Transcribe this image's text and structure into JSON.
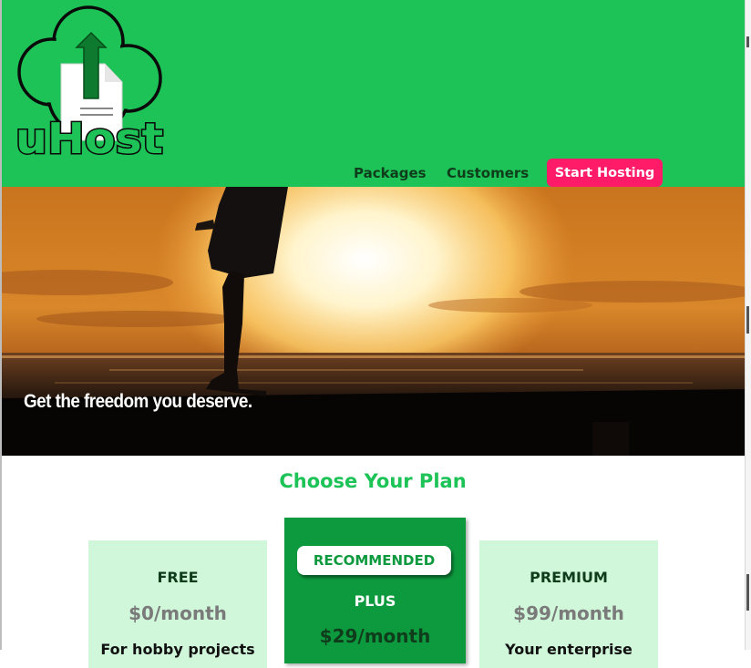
{
  "header": {
    "logo_text": "uHost",
    "nav": [
      {
        "label": "Packages"
      },
      {
        "label": "Customers"
      }
    ],
    "cta_label": "Start Hosting"
  },
  "hero": {
    "text": "Get the freedom you deserve."
  },
  "plans": {
    "title": "Choose Your Plan",
    "items": [
      {
        "name": "FREE",
        "price": "$0/month",
        "desc": "For hobby projects"
      },
      {
        "badge": "RECOMMENDED",
        "name": "PLUS",
        "price": "$29/month"
      },
      {
        "name": "PREMIUM",
        "price": "$99/month",
        "desc": "Your enterprise"
      }
    ]
  },
  "colors": {
    "brand_green": "#1dc356",
    "dark_green": "#0d9a3e",
    "light_green": "#d0f7d9",
    "cta_pink": "#ff1b68"
  }
}
